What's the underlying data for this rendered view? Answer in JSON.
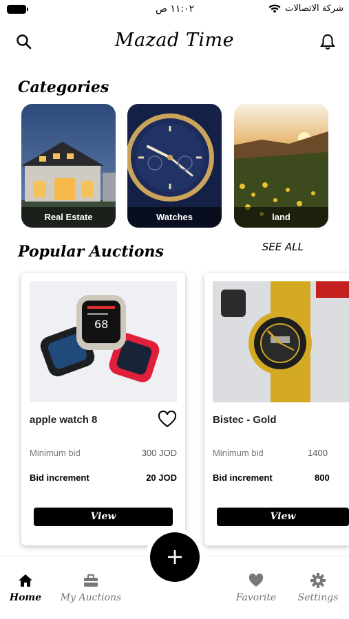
{
  "status_bar": {
    "time": "١١:٠٢ ص",
    "carrier": "شركة الاتصالات",
    "icons": [
      "battery-icon",
      "wifi-icon"
    ]
  },
  "header": {
    "title": "Mazad Time",
    "icons": [
      "search-icon",
      "bell-icon"
    ]
  },
  "categories": {
    "title": "Categories",
    "items": [
      {
        "label": "Real Estate"
      },
      {
        "label": "Watches"
      },
      {
        "label": "land"
      }
    ]
  },
  "popular": {
    "title": "Popular Auctions",
    "see_all": "SEE ALL",
    "items": [
      {
        "name": "apple watch 8",
        "min_label": "Minimum bid",
        "min_value": "300 JOD",
        "inc_label": "Bid increment",
        "inc_value": "20 JOD",
        "button": "View"
      },
      {
        "name": "Bistec - Gold",
        "min_label": "Minimum bid",
        "min_value": "1400",
        "inc_label": "Bid increment",
        "inc_value": "800",
        "button": "View"
      }
    ]
  },
  "bottom_nav": {
    "fab": "+",
    "items": [
      {
        "label": "Home",
        "icon": "home-icon",
        "active": true
      },
      {
        "label": "My Auctions",
        "icon": "briefcase-icon",
        "active": false
      },
      {
        "label": "Favorite",
        "icon": "heart-icon",
        "active": false
      },
      {
        "label": "Settings",
        "icon": "gear-icon",
        "active": false
      }
    ]
  },
  "colors": {
    "accent": "#000000",
    "background": "#ffffff",
    "muted_text": "#777777"
  }
}
